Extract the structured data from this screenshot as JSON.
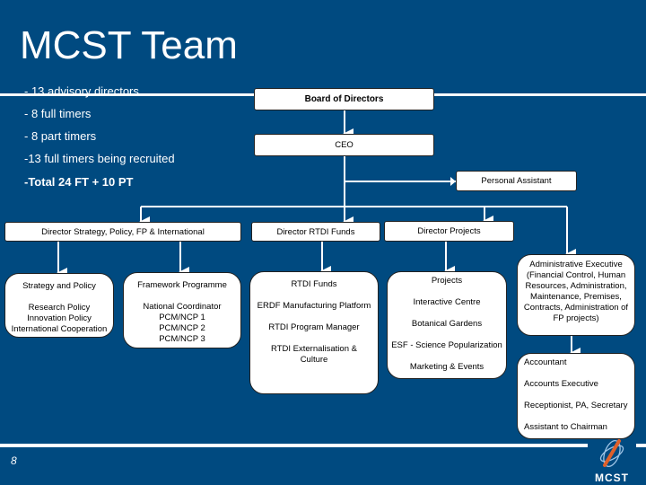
{
  "title": "MCST Team",
  "bullets": [
    "- 13 advisory directors",
    "- 8 full timers",
    "- 8 part timers",
    "-13 full timers being recruited",
    "-Total 24 FT + 10 PT"
  ],
  "org": {
    "board": "Board of Directors",
    "ceo": "CEO",
    "pa": "Personal Assistant",
    "dir_strategy": "Director Strategy, Policy, FP & International",
    "dir_rtdi": "Director RTDI Funds",
    "dir_projects": "Director Projects",
    "strategy_box": {
      "title": "Strategy and Policy",
      "items": [
        "Research Policy",
        "Innovation Policy",
        "International Cooperation"
      ]
    },
    "framework_box": {
      "title": "Framework Programme",
      "items": [
        "National Coordinator",
        "PCM/NCP 1",
        "PCM/NCP 2",
        "PCM/NCP 3"
      ]
    },
    "rtdi_box": {
      "title": "RTDI Funds",
      "items": [
        "ERDF Manufacturing Platform",
        "RTDI Program Manager",
        "RTDI Externalisation &",
        "Culture"
      ]
    },
    "projects_box": {
      "title": "Projects",
      "items": [
        "Interactive Centre",
        "Botanical Gardens",
        "ESF - Science Popularization",
        "Marketing & Events"
      ]
    },
    "admin_box": {
      "lines": [
        "Administrative Executive",
        "(Financial Control, Human",
        "Resources, Administration,",
        "Maintenance,  Premises,",
        "Contracts, Administration of",
        "FP projects)"
      ]
    },
    "accounts_box": {
      "items": [
        "Accountant",
        "Accounts Executive",
        "Receptionist, PA, Secretary",
        "Assistant to Chairman"
      ]
    }
  },
  "footer": {
    "page_number": "8",
    "logo_text": "MCST"
  },
  "colors": {
    "background": "#004a80",
    "box": "#ffffff",
    "logo_accent": "#e0602a"
  }
}
